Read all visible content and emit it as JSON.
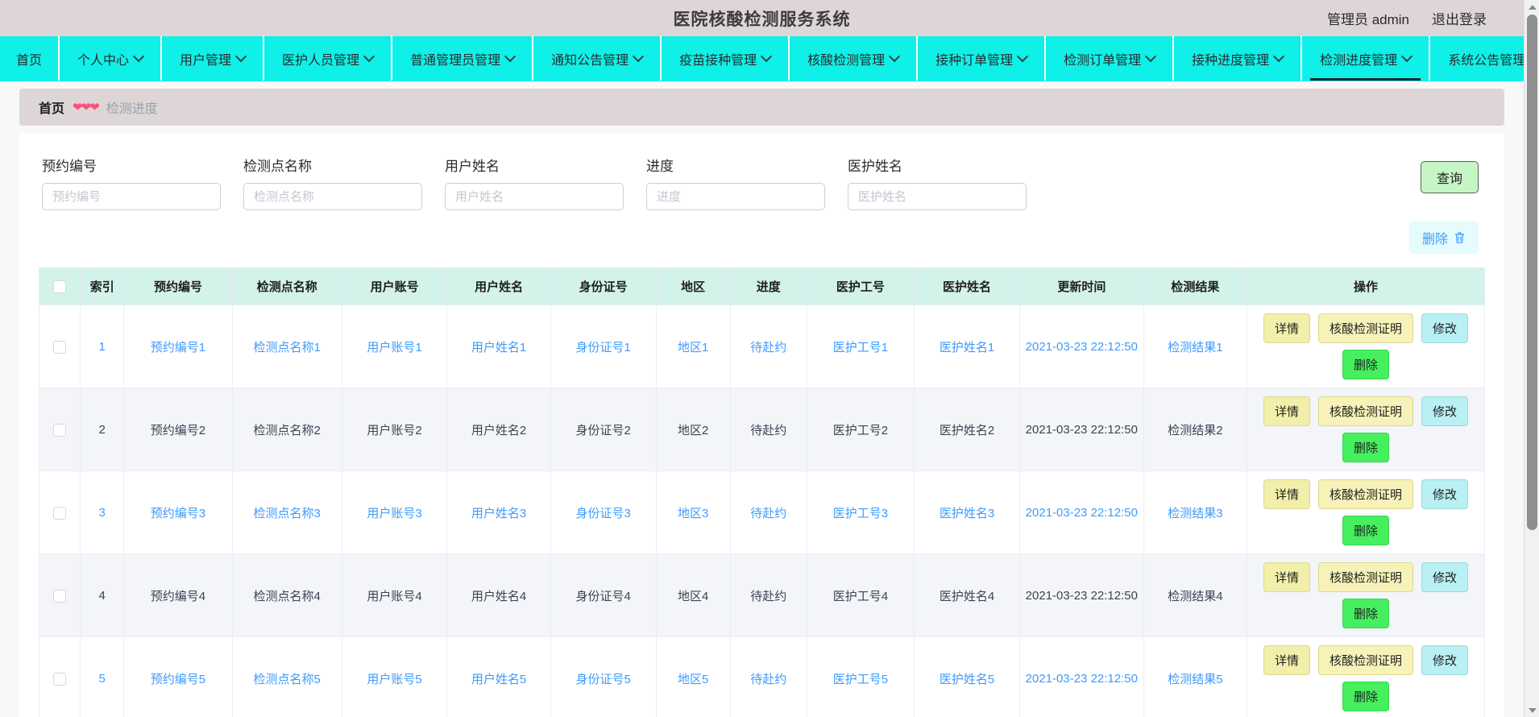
{
  "header": {
    "title": "医院核酸检测服务系统",
    "user_label": "管理员 admin",
    "logout_label": "退出登录"
  },
  "nav": {
    "items": [
      {
        "label": "首页",
        "has_caret": false,
        "active": false
      },
      {
        "label": "个人中心",
        "has_caret": true,
        "active": false
      },
      {
        "label": "用户管理",
        "has_caret": true,
        "active": false
      },
      {
        "label": "医护人员管理",
        "has_caret": true,
        "active": false
      },
      {
        "label": "普通管理员管理",
        "has_caret": true,
        "active": false
      },
      {
        "label": "通知公告管理",
        "has_caret": true,
        "active": false
      },
      {
        "label": "疫苗接种管理",
        "has_caret": true,
        "active": false
      },
      {
        "label": "核酸检测管理",
        "has_caret": true,
        "active": false
      },
      {
        "label": "接种订单管理",
        "has_caret": true,
        "active": false
      },
      {
        "label": "检测订单管理",
        "has_caret": true,
        "active": false
      },
      {
        "label": "接种进度管理",
        "has_caret": true,
        "active": false
      },
      {
        "label": "检测进度管理",
        "has_caret": true,
        "active": true
      },
      {
        "label": "系统公告管理",
        "has_caret": true,
        "active": false
      }
    ]
  },
  "breadcrumb": {
    "home": "首页",
    "separator": "❤❤❤",
    "current": "检测进度"
  },
  "filters": {
    "fields": [
      {
        "label": "预约编号",
        "placeholder": "预约编号",
        "value": ""
      },
      {
        "label": "检测点名称",
        "placeholder": "检测点名称",
        "value": ""
      },
      {
        "label": "用户姓名",
        "placeholder": "用户姓名",
        "value": ""
      },
      {
        "label": "进度",
        "placeholder": "进度",
        "value": ""
      },
      {
        "label": "医护姓名",
        "placeholder": "医护姓名",
        "value": ""
      }
    ],
    "query_label": "查询"
  },
  "toolbar": {
    "delete_label": "删除",
    "delete_icon": "trash-icon"
  },
  "table": {
    "columns": [
      "索引",
      "预约编号",
      "检测点名称",
      "用户账号",
      "用户姓名",
      "身份证号",
      "地区",
      "进度",
      "医护工号",
      "医护姓名",
      "更新时间",
      "检测结果",
      "操作"
    ],
    "action_labels": {
      "detail": "详情",
      "cert": "核酸检测证明",
      "edit": "修改",
      "delete": "删除"
    },
    "rows": [
      {
        "index": "1",
        "appointment_no": "预约编号1",
        "site_name": "检测点名称1",
        "user_account": "用户账号1",
        "user_name": "用户姓名1",
        "id_number": "身份证号1",
        "region": "地区1",
        "progress": "待赴约",
        "staff_no": "医护工号1",
        "staff_name": "医护姓名1",
        "updated_at": "2021-03-23 22:12:50",
        "result": "检测结果1"
      },
      {
        "index": "2",
        "appointment_no": "预约编号2",
        "site_name": "检测点名称2",
        "user_account": "用户账号2",
        "user_name": "用户姓名2",
        "id_number": "身份证号2",
        "region": "地区2",
        "progress": "待赴约",
        "staff_no": "医护工号2",
        "staff_name": "医护姓名2",
        "updated_at": "2021-03-23 22:12:50",
        "result": "检测结果2"
      },
      {
        "index": "3",
        "appointment_no": "预约编号3",
        "site_name": "检测点名称3",
        "user_account": "用户账号3",
        "user_name": "用户姓名3",
        "id_number": "身份证号3",
        "region": "地区3",
        "progress": "待赴约",
        "staff_no": "医护工号3",
        "staff_name": "医护姓名3",
        "updated_at": "2021-03-23 22:12:50",
        "result": "检测结果3"
      },
      {
        "index": "4",
        "appointment_no": "预约编号4",
        "site_name": "检测点名称4",
        "user_account": "用户账号4",
        "user_name": "用户姓名4",
        "id_number": "身份证号4",
        "region": "地区4",
        "progress": "待赴约",
        "staff_no": "医护工号4",
        "staff_name": "医护姓名4",
        "updated_at": "2021-03-23 22:12:50",
        "result": "检测结果4"
      },
      {
        "index": "5",
        "appointment_no": "预约编号5",
        "site_name": "检测点名称5",
        "user_account": "用户账号5",
        "user_name": "用户姓名5",
        "id_number": "身份证号5",
        "region": "地区5",
        "progress": "待赴约",
        "staff_no": "医护工号5",
        "staff_name": "医护姓名5",
        "updated_at": "2021-03-23 22:12:50",
        "result": "检测结果5"
      }
    ]
  },
  "colors": {
    "nav_bg": "#0ff0e8",
    "header_bg": "#ded6d6",
    "table_header_bg": "#d3f2ea",
    "link_blue": "#3d9bfd",
    "btn_query_bg": "#c6f5c6",
    "btn_delete_bg": "#46ef5e",
    "btn_edit_bg": "#b8f0f3",
    "btn_detail_bg": "#f2efaa",
    "crumb_heart": "#ff4d78"
  }
}
